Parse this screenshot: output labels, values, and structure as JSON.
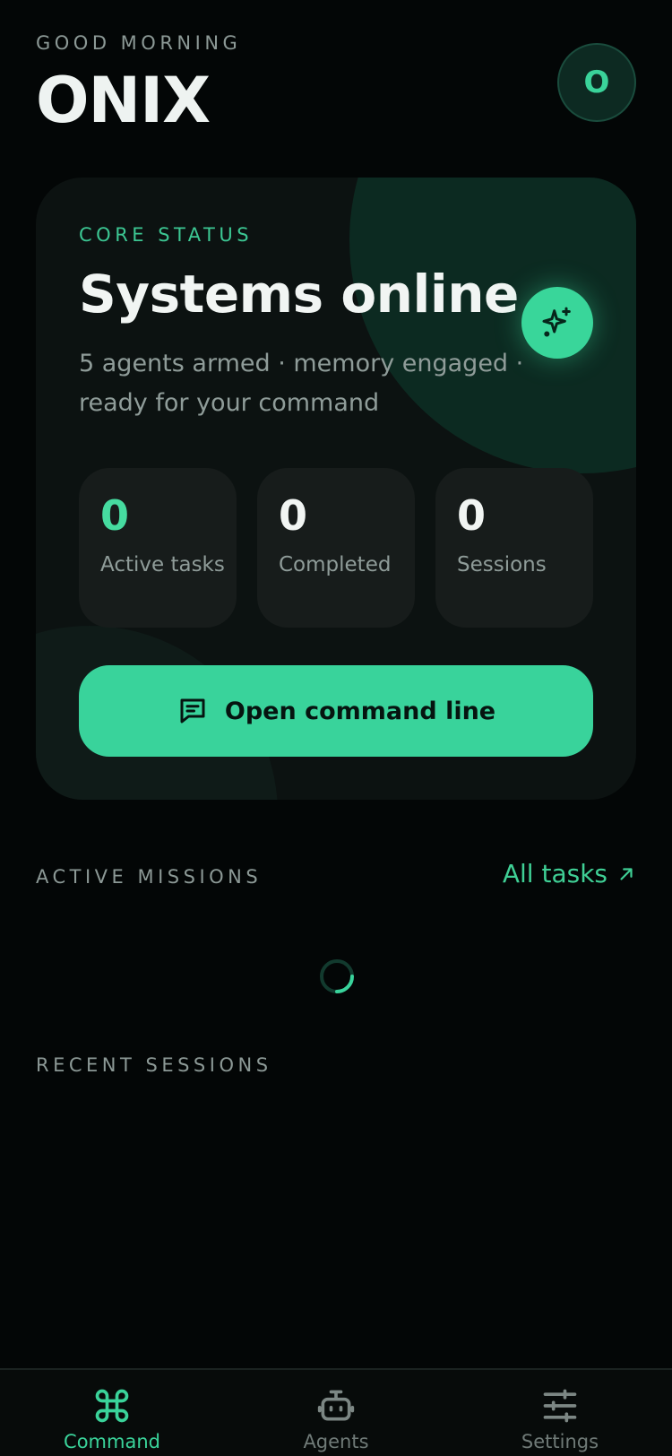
{
  "header": {
    "greeting": "GOOD MORNING",
    "brand": "ONIX",
    "avatar_initial": "O"
  },
  "status_card": {
    "label": "CORE STATUS",
    "headline": "Systems online",
    "subline": "5 agents armed · memory engaged · ready for your command",
    "stats": [
      {
        "value": "0",
        "label": "Active tasks"
      },
      {
        "value": "0",
        "label": "Completed"
      },
      {
        "value": "0",
        "label": "Sessions"
      }
    ],
    "command_button": "Open command line"
  },
  "active_missions": {
    "label": "ACTIVE MISSIONS",
    "link": "All tasks"
  },
  "recent_sessions": {
    "label": "RECENT SESSIONS"
  },
  "bottom_nav": {
    "items": [
      {
        "label": "Command",
        "icon": "command-icon",
        "active": true
      },
      {
        "label": "Agents",
        "icon": "robot-icon",
        "active": false
      },
      {
        "label": "Settings",
        "icon": "sliders-icon",
        "active": false
      }
    ]
  },
  "colors": {
    "accent": "#39d39b",
    "background": "#030606",
    "card": "#0c1211"
  }
}
